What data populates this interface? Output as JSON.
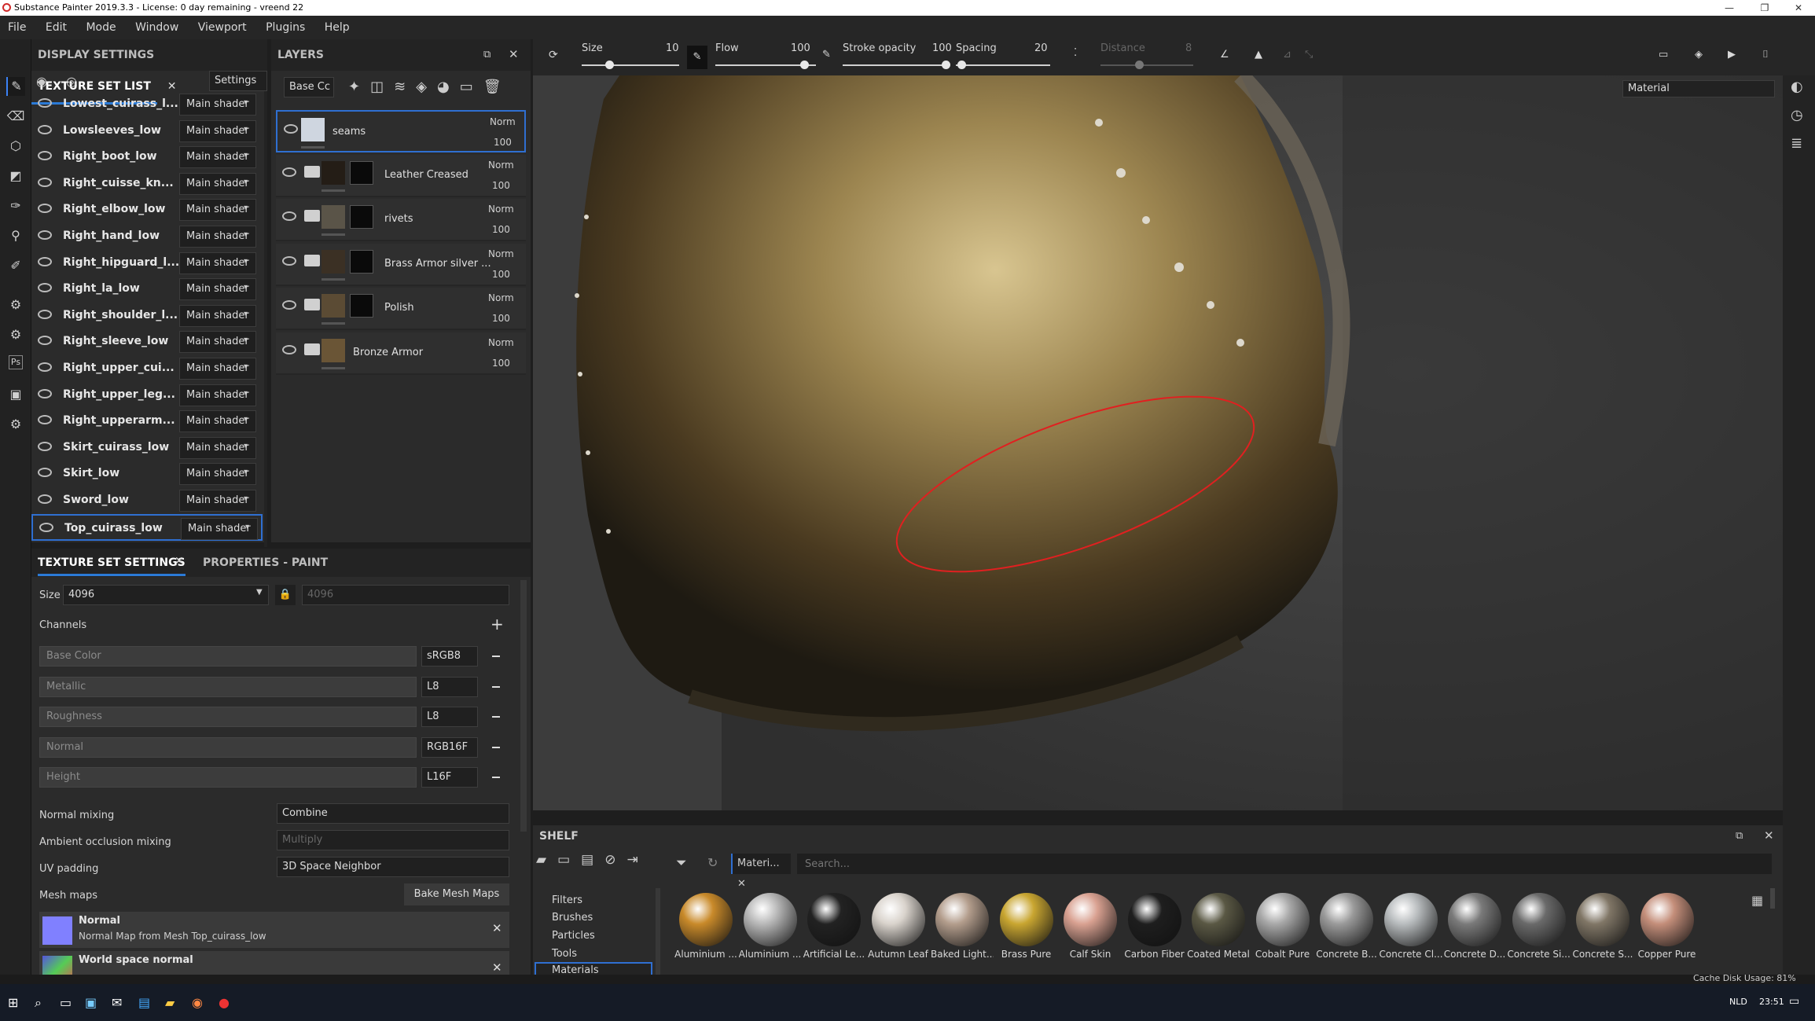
{
  "window": {
    "title": "Substance Painter 2019.3.3 - License: 0 day remaining - vreend 22"
  },
  "menu": [
    "File",
    "Edit",
    "Mode",
    "Window",
    "Viewport",
    "Plugins",
    "Help"
  ],
  "tsl": {
    "tab_display": "DISPLAY SETTINGS",
    "tab_tsl": "TEXTURE SET LIST",
    "settings_label": "Settings",
    "rows": [
      {
        "name": "Lowest_cuirass_l...",
        "shader": "Main shader"
      },
      {
        "name": "Lowsleeves_low",
        "shader": "Main shader"
      },
      {
        "name": "Right_boot_low",
        "shader": "Main shader"
      },
      {
        "name": "Right_cuisse_kn...",
        "shader": "Main shader"
      },
      {
        "name": "Right_elbow_low",
        "shader": "Main shader"
      },
      {
        "name": "Right_hand_low",
        "shader": "Main shader"
      },
      {
        "name": "Right_hipguard_l...",
        "shader": "Main shader"
      },
      {
        "name": "Right_la_low",
        "shader": "Main shader"
      },
      {
        "name": "Right_shoulder_l...",
        "shader": "Main shader"
      },
      {
        "name": "Right_sleeve_low",
        "shader": "Main shader"
      },
      {
        "name": "Right_upper_cui...",
        "shader": "Main shader"
      },
      {
        "name": "Right_upper_leg...",
        "shader": "Main shader"
      },
      {
        "name": "Right_upperarm...",
        "shader": "Main shader"
      },
      {
        "name": "Skirt_cuirass_low",
        "shader": "Main shader"
      },
      {
        "name": "Skirt_low",
        "shader": "Main shader"
      },
      {
        "name": "Sword_low",
        "shader": "Main shader"
      },
      {
        "name": "Top_cuirass_low",
        "shader": "Main shader"
      }
    ]
  },
  "layers": {
    "title": "LAYERS",
    "channel_select": "Base Cc",
    "items": [
      {
        "name": "seams",
        "blend": "Norm",
        "opacity": "100"
      },
      {
        "name": "Leather Creased",
        "blend": "Norm",
        "opacity": "100"
      },
      {
        "name": "rivets",
        "blend": "Norm",
        "opacity": "100"
      },
      {
        "name": "Brass Armor silver ...",
        "blend": "Norm",
        "opacity": "100"
      },
      {
        "name": "Polish",
        "blend": "Norm",
        "opacity": "100"
      },
      {
        "name": "Bronze Armor",
        "blend": "Norm",
        "opacity": "100"
      }
    ]
  },
  "tss": {
    "tab_tss": "TEXTURE SET SETTINGS",
    "tab_props": "PROPERTIES - PAINT",
    "size_label": "Size",
    "size_value": "4096",
    "size_value2": "4096",
    "channels_label": "Channels",
    "channels": [
      {
        "name": "Base Color",
        "format": "sRGB8"
      },
      {
        "name": "Metallic",
        "format": "L8"
      },
      {
        "name": "Roughness",
        "format": "L8"
      },
      {
        "name": "Normal",
        "format": "RGB16F"
      },
      {
        "name": "Height",
        "format": "L16F"
      }
    ],
    "normal_mixing_label": "Normal mixing",
    "normal_mixing_value": "Combine",
    "ao_mixing_label": "Ambient occlusion mixing",
    "ao_mixing_value": "Multiply",
    "uv_padding_label": "UV padding",
    "uv_padding_value": "3D Space Neighbor",
    "mesh_maps_label": "Mesh maps",
    "bake_button": "Bake Mesh Maps",
    "mesh_maps": [
      {
        "title": "Normal",
        "desc": "Normal Map from Mesh Top_cuirass_low"
      },
      {
        "title": "World space normal",
        "desc": ""
      }
    ]
  },
  "toolbar": {
    "size_label": "Size",
    "size_value": "10",
    "flow_label": "Flow",
    "flow_value": "100",
    "opacity_label": "Stroke opacity",
    "opacity_value": "100",
    "spacing_label": "Spacing",
    "spacing_value": "20",
    "distance_label": "Distance",
    "distance_value": "8",
    "view_mode": "Material"
  },
  "shelf": {
    "title": "SHELF",
    "filter_tag": "Materi...",
    "search_placeholder": "Search...",
    "categories": [
      "Filters",
      "Brushes",
      "Particles",
      "Tools",
      "Materials"
    ],
    "materials": [
      {
        "name": "Aluminium ...",
        "color": "#c98a2a"
      },
      {
        "name": "Aluminium ...",
        "color": "#b8b8b8"
      },
      {
        "name": "Artificial Le...",
        "color": "#222222"
      },
      {
        "name": "Autumn Leaf",
        "color": "#d9d3cc"
      },
      {
        "name": "Baked Light...",
        "color": "#b39d8c"
      },
      {
        "name": "Brass Pure",
        "color": "#c9a631"
      },
      {
        "name": "Calf Skin",
        "color": "#d9a191"
      },
      {
        "name": "Carbon Fiber",
        "color": "#1e1e1e"
      },
      {
        "name": "Coated Metal",
        "color": "#5a5844"
      },
      {
        "name": "Cobalt Pure",
        "color": "#a8a8a8"
      },
      {
        "name": "Concrete B...",
        "color": "#9a9a9a"
      },
      {
        "name": "Concrete Cl...",
        "color": "#b8bcbe"
      },
      {
        "name": "Concrete D...",
        "color": "#7a7a7a"
      },
      {
        "name": "Concrete Si...",
        "color": "#6a6a6a"
      },
      {
        "name": "Concrete S...",
        "color": "#807666"
      },
      {
        "name": "Copper Pure",
        "color": "#c48e7a"
      }
    ]
  },
  "status": {
    "cache": "Cache Disk Usage: 81%"
  },
  "taskbar": {
    "lang": "NLD",
    "time": "23:51"
  }
}
